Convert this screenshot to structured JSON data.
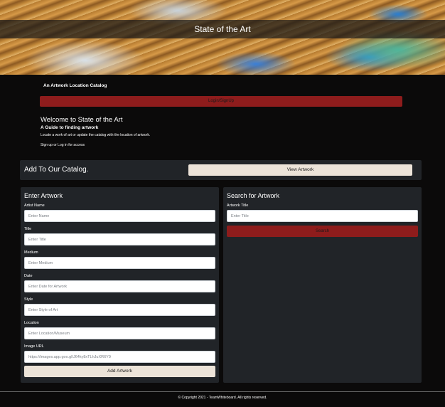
{
  "hero": {
    "title": "State of the Art"
  },
  "intro": {
    "catalog_subtitle": "An Artwork Location Catalog",
    "login_label": "Login/SignUp",
    "welcome_title": "Welcome to State of the Art",
    "welcome_sub": "A Guide to finding artwork",
    "welcome_desc": "Locate a work of art or update the catalog with the location of artwork.",
    "sign_prompt": "Sign up or Log in for access"
  },
  "catalog": {
    "title": "Add To Our Catalog.",
    "view_button": "View Artwork"
  },
  "enter_artwork": {
    "title": "Enter Artwork",
    "fields": [
      {
        "label": "Artist Name",
        "placeholder": "Enter Name",
        "value": ""
      },
      {
        "label": "Title",
        "placeholder": "Enter Title",
        "value": ""
      },
      {
        "label": "Medium",
        "placeholder": "Enter Medium",
        "value": ""
      },
      {
        "label": "Date",
        "placeholder": "Enter Date for Artwork",
        "value": ""
      },
      {
        "label": "Style",
        "placeholder": "Enter Style of Art",
        "value": ""
      },
      {
        "label": "Location",
        "placeholder": "Enter Location/Museum",
        "value": ""
      },
      {
        "label": "Image URL",
        "placeholder": "https://images.app.goo.gl/J64ky8xTLhJuXR6Y9",
        "value": ""
      }
    ],
    "add_button": "Add Artwork"
  },
  "search_artwork": {
    "title": "Search for Artwork",
    "field_label": "Artwork Title",
    "placeholder": "Enter Title",
    "search_button": "Search"
  },
  "footer": {
    "text": "© Copyright 2021 - TeamWhiteboard. All rights reserved."
  },
  "colors": {
    "background": "#0b0a0a",
    "panel": "#212428",
    "accent_red": "#8e1c1c",
    "button_cream": "#ece3d8"
  }
}
